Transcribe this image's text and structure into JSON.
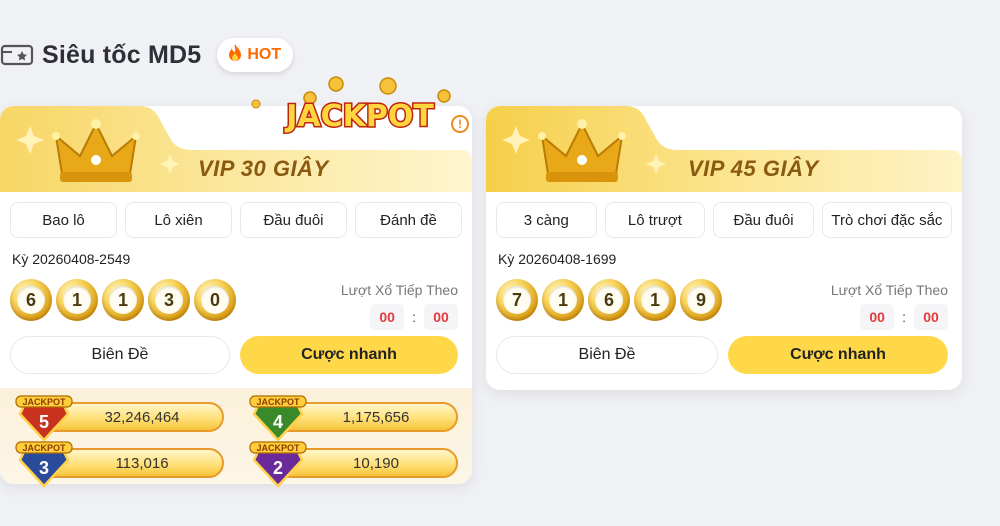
{
  "section": {
    "title": "Siêu tốc MD5",
    "hot_label": "HOT",
    "ticket_icon": "ticket-icon",
    "fire_icon": "fire-icon"
  },
  "jackpot_logo_text": "JACKPOT",
  "cards": [
    {
      "title": "VIP 30 GIÂY",
      "tabs": [
        "Bao lô",
        "Lô xiên",
        "Đầu đuôi",
        "Đánh đề"
      ],
      "ky": "Kỳ 20260408-2549",
      "balls": [
        "6",
        "1",
        "1",
        "3",
        "0"
      ],
      "next_draw_label": "Lượt Xổ Tiếp Theo",
      "countdown": {
        "min": "00",
        "sep": ":",
        "sec": "00"
      },
      "btn_secondary": "Biên Đề",
      "btn_primary": "Cược nhanh",
      "jackpots": [
        {
          "level": "5",
          "value": "32,246,464",
          "color": "#c8321f"
        },
        {
          "level": "4",
          "value": "1,175,656",
          "color": "#3a8a2a"
        },
        {
          "level": "3",
          "value": "113,016",
          "color": "#2a4a9a"
        },
        {
          "level": "2",
          "value": "10,190",
          "color": "#6a2a9a"
        }
      ],
      "badge_text": "JACKPOT"
    },
    {
      "title": "VIP 45 GIÂY",
      "tabs": [
        "3 càng",
        "Lô trượt",
        "Đầu đuôi",
        "Trò chơi đặc sắc"
      ],
      "ky": "Kỳ 20260408-1699",
      "balls": [
        "7",
        "1",
        "6",
        "1",
        "9"
      ],
      "next_draw_label": "Lượt Xổ Tiếp Theo",
      "countdown": {
        "min": "00",
        "sep": ":",
        "sec": "00"
      },
      "btn_secondary": "Biên Đề",
      "btn_primary": "Cược nhanh"
    }
  ],
  "colors": {
    "gold": "#ffd84a",
    "accent_orange": "#ff6a00",
    "banner_text": "#8a5a10",
    "countdown_red": "#e23b3b"
  },
  "info_icon_glyph": "!"
}
